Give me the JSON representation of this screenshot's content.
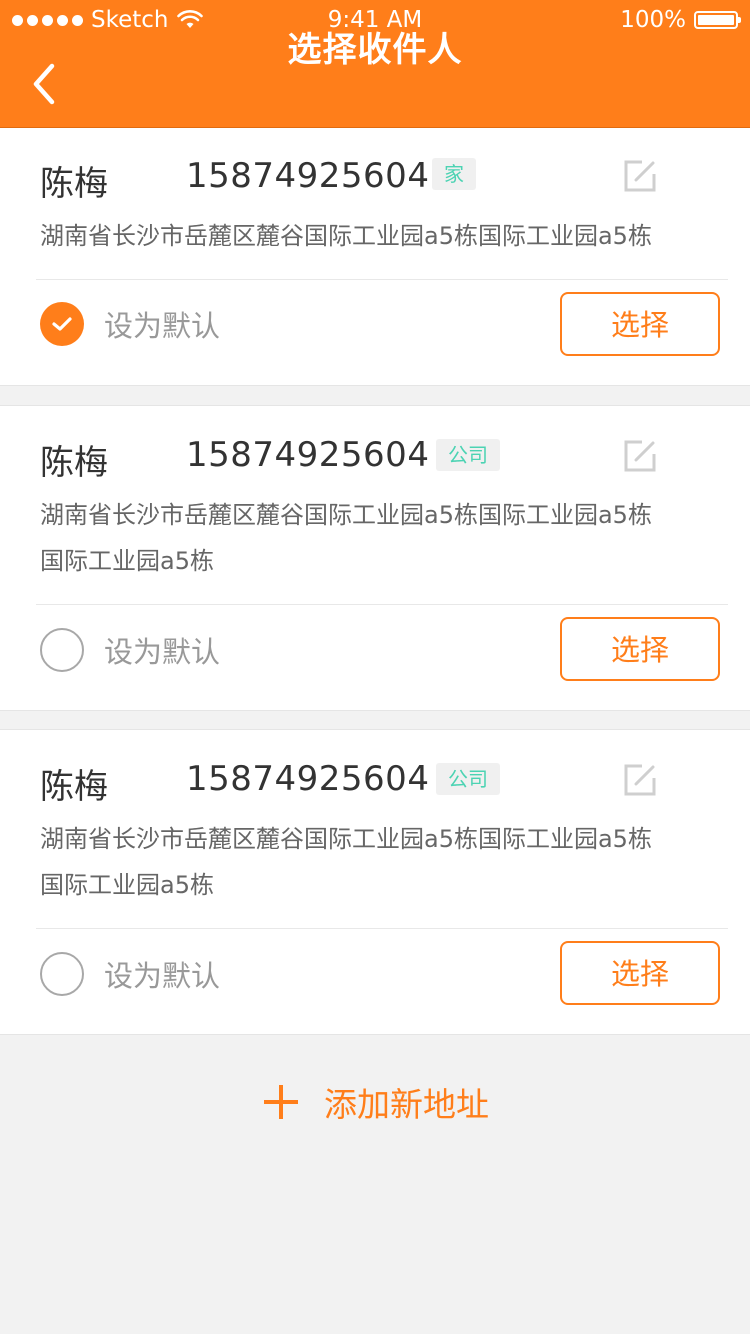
{
  "status_bar": {
    "carrier": "Sketch",
    "time": "9:41 AM",
    "battery": "100%"
  },
  "nav": {
    "title": "选择收件人"
  },
  "addresses": [
    {
      "name": "陈梅",
      "phone": "15874925604",
      "tag": "家",
      "address_lines": [
        "湖南省长沙市岳麓区麓谷国际工业园a5栋国际工业园a5栋"
      ],
      "default_label": "设为默认",
      "is_default": true,
      "select_label": "选择"
    },
    {
      "name": "陈梅",
      "phone": "15874925604",
      "tag": "公司",
      "address_lines": [
        "湖南省长沙市岳麓区麓谷国际工业园a5栋国际工业园a5栋",
        "国际工业园a5栋"
      ],
      "default_label": "设为默认",
      "is_default": false,
      "select_label": "选择"
    },
    {
      "name": "陈梅",
      "phone": "15874925604",
      "tag": "公司",
      "address_lines": [
        "湖南省长沙市岳麓区麓谷国际工业园a5栋国际工业园a5栋",
        "国际工业园a5栋"
      ],
      "default_label": "设为默认",
      "is_default": false,
      "select_label": "选择"
    }
  ],
  "add_address": {
    "label": "添加新地址"
  },
  "colors": {
    "accent": "#ff7e1a",
    "tag_text": "#4cd3b3",
    "background": "#f2f2f2"
  },
  "icons": {
    "back": "chevron-left-icon",
    "edit": "edit-icon",
    "check": "check-icon",
    "add": "plus-icon",
    "wifi": "wifi-icon",
    "battery": "battery-icon"
  }
}
